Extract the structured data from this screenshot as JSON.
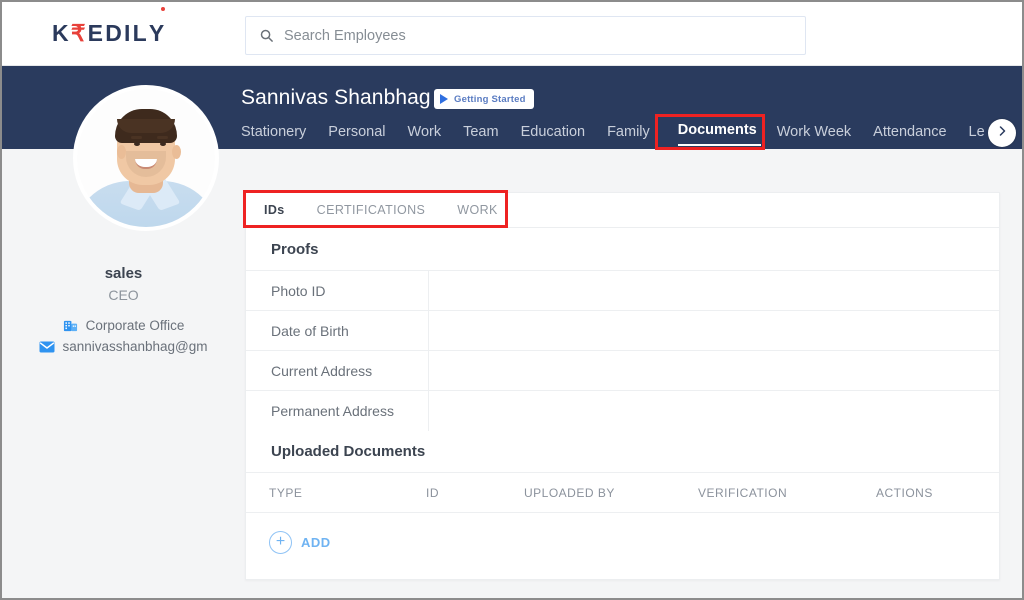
{
  "brand": {
    "logo_part1": "K",
    "logo_rupee": "₹",
    "logo_part2": "EDIL",
    "logo_part3": "Y",
    "accent_red": "#e8413a",
    "navy": "#2a3b5e",
    "blue": "#6fb3f2"
  },
  "search": {
    "placeholder": "Search Employees",
    "value": "",
    "icon": "search-icon"
  },
  "profile": {
    "employee_name": "Sannivas Shanbhag",
    "getting_started_label": "Getting Started",
    "getting_started_icon": "play-icon",
    "sidebar": {
      "name": "sales",
      "role": "CEO",
      "office": "Corporate Office",
      "office_icon": "building-icon",
      "email": "sannivasshanbhag@gm",
      "email_icon": "envelope-icon",
      "avatar_alt": "employee-photo"
    }
  },
  "tabs": [
    {
      "label": "Stationery",
      "active": false
    },
    {
      "label": "Personal",
      "active": false
    },
    {
      "label": "Work",
      "active": false
    },
    {
      "label": "Team",
      "active": false
    },
    {
      "label": "Education",
      "active": false
    },
    {
      "label": "Family",
      "active": false
    },
    {
      "label": "Documents",
      "active": true
    },
    {
      "label": "Work Week",
      "active": false
    },
    {
      "label": "Attendance",
      "active": false
    },
    {
      "label": "Le",
      "active": false
    }
  ],
  "tabs_next_icon": "chevron-right-icon",
  "subtabs": [
    {
      "label": "IDs",
      "active": true
    },
    {
      "label": "CERTIFICATIONS",
      "active": false
    },
    {
      "label": "WORK",
      "active": false
    }
  ],
  "proofs": {
    "title": "Proofs",
    "rows": [
      {
        "label": "Photo ID",
        "value": ""
      },
      {
        "label": "Date of Birth",
        "value": ""
      },
      {
        "label": "Current Address",
        "value": ""
      },
      {
        "label": "Permanent Address",
        "value": ""
      }
    ]
  },
  "uploaded_documents": {
    "title": "Uploaded Documents",
    "columns": {
      "type": "TYPE",
      "id": "ID",
      "uploaded_by": "UPLOADED BY",
      "verification": "VERIFICATION",
      "actions": "ACTIONS"
    },
    "rows": [],
    "add_label": "ADD",
    "add_icon": "plus-circle-icon"
  },
  "highlights": {
    "color": "#ee2222",
    "targets": [
      "documents-tab",
      "documents-subtabs"
    ]
  }
}
